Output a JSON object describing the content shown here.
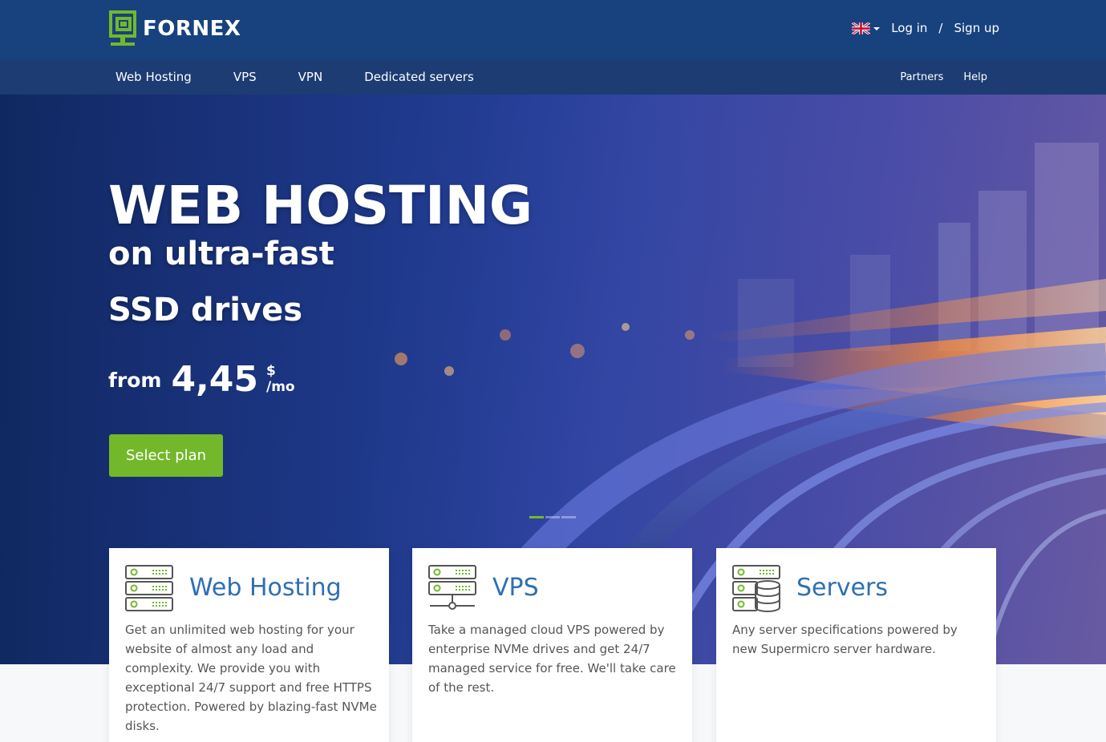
{
  "header": {
    "logo_text": "FORNEX",
    "login_label": "Log in",
    "separator": "/",
    "signup_label": "Sign up",
    "language_icon": "uk-flag-icon"
  },
  "nav": {
    "items": [
      "Web Hosting",
      "VPS",
      "VPN",
      "Dedicated servers"
    ],
    "right_items": [
      "Partners",
      "Help"
    ]
  },
  "hero": {
    "title": "WEB HOSTING",
    "subtitle_line1": "on ultra-fast",
    "subtitle_line2": "SSD drives",
    "price_prefix": "from",
    "price_value": "4,45",
    "price_currency": "$",
    "price_period": "/mo",
    "cta_label": "Select plan",
    "slides_total": 3,
    "active_slide": 1
  },
  "cards": [
    {
      "title": "Web Hosting",
      "icon": "server-rack-icon",
      "text": "Get an unlimited web hosting for your website of almost any load and complexity. We provide you with exceptional 24/7 support and free HTTPS protection. Powered by blazing-fast NVMe disks."
    },
    {
      "title": "VPS",
      "icon": "network-server-icon",
      "text": "Take a managed cloud VPS powered by enterprise NVMe drives and get 24/7 managed service for free. We'll take care of the rest."
    },
    {
      "title": "Servers",
      "icon": "server-database-icon",
      "text": "Any server specifications powered by new Supermicro server hardware."
    }
  ],
  "colors": {
    "topbar": "#17427e",
    "navbar": "#1c3c73",
    "accent_green": "#73b82a",
    "card_title_blue": "#2f6fb2"
  }
}
